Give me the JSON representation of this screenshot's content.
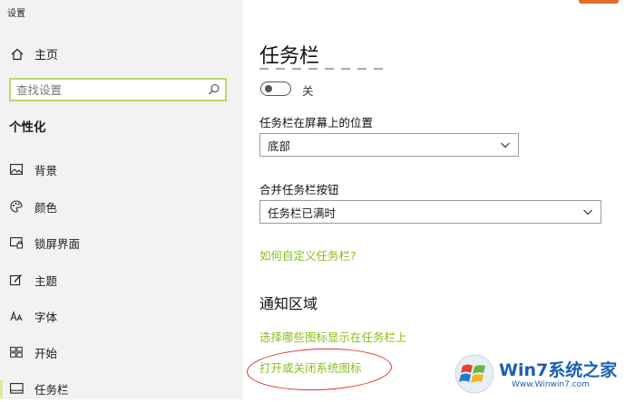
{
  "window": {
    "title": "设置"
  },
  "sidebar": {
    "home_label": "主页",
    "search": {
      "placeholder": "查找设置"
    },
    "section_title": "个性化",
    "items": [
      {
        "label": "背景",
        "icon": "image-icon"
      },
      {
        "label": "颜色",
        "icon": "palette-icon"
      },
      {
        "label": "锁屏界面",
        "icon": "lock-screen-icon"
      },
      {
        "label": "主题",
        "icon": "theme-icon"
      },
      {
        "label": "字体",
        "icon": "font-icon"
      },
      {
        "label": "开始",
        "icon": "start-icon"
      },
      {
        "label": "任务栏",
        "icon": "taskbar-icon",
        "active": true
      }
    ]
  },
  "main": {
    "title": "任务栏",
    "toggle": {
      "state_label": "关",
      "on": false
    },
    "position": {
      "label": "任务栏在屏幕上的位置",
      "value": "底部"
    },
    "combine": {
      "label": "合并任务栏按钮",
      "value": "任务栏已满时"
    },
    "customize_link": "如何自定义任务栏?",
    "notification": {
      "title": "通知区域",
      "link1": "选择哪些图标显示在任务栏上",
      "link2": "打开或关闭系统图标"
    }
  },
  "watermark": {
    "brand": "Win7系统之家",
    "url": "Www.Winwin7.com"
  },
  "colors": {
    "accent_link": "#8bbd1c",
    "search_border": "#b7d96a",
    "annotation": "#d6332d"
  }
}
